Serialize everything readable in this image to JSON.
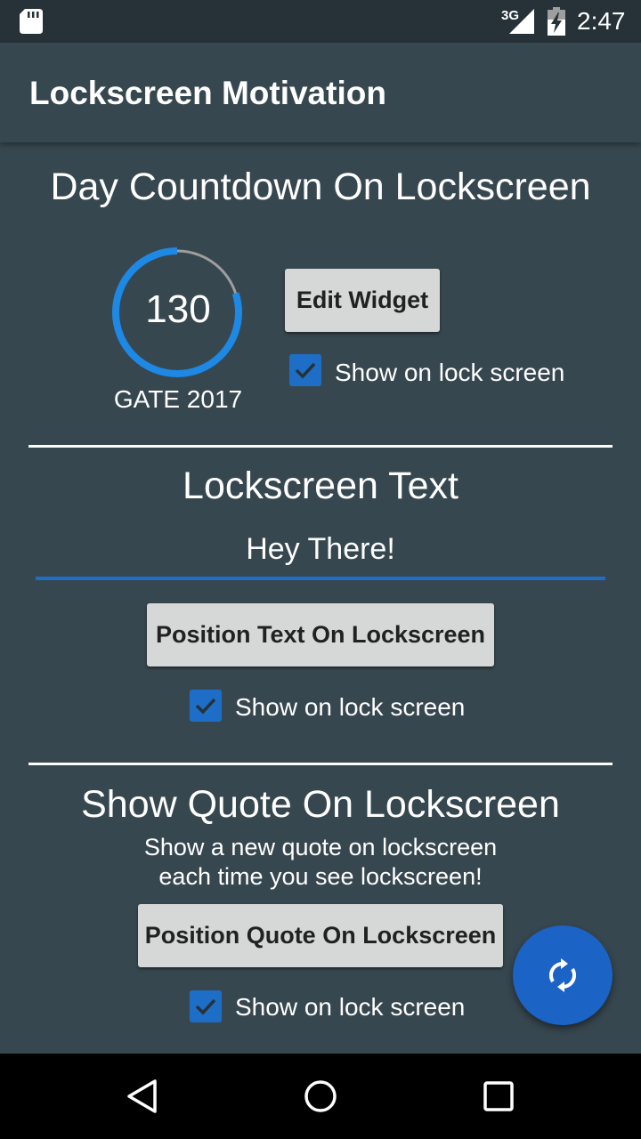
{
  "status_bar": {
    "network": "3G",
    "time": "2:47"
  },
  "app_bar": {
    "title": "Lockscreen Motivation"
  },
  "countdown_section": {
    "title": "Day Countdown On Lockscreen",
    "days_value": "130",
    "event_label": "GATE 2017",
    "progress_fraction": 0.8,
    "edit_button_label": "Edit Widget",
    "show_on_lock_screen_label": "Show on lock screen",
    "show_on_lock_screen_checked": true
  },
  "text_section": {
    "title": "Lockscreen Text",
    "input_value": "Hey There!",
    "position_button_label": "Position Text On Lockscreen",
    "show_on_lock_screen_label": "Show on lock screen",
    "show_on_lock_screen_checked": true
  },
  "quote_section": {
    "title": "Show Quote On Lockscreen",
    "description_line1": "Show a new quote on lockscreen",
    "description_line2": "each time you see lockscreen!",
    "position_button_label": "Position Quote On Lockscreen",
    "show_on_lock_screen_label": "Show on lock screen",
    "show_on_lock_screen_checked": true
  },
  "fab": {
    "icon": "refresh-icon"
  },
  "navigation_bar": {
    "icons": [
      "back-icon",
      "home-icon",
      "recents-icon"
    ]
  },
  "colors": {
    "background": "#37474f",
    "status_bar": "#263238",
    "accent": "#1e6ec7",
    "button": "#d6d7d7"
  }
}
